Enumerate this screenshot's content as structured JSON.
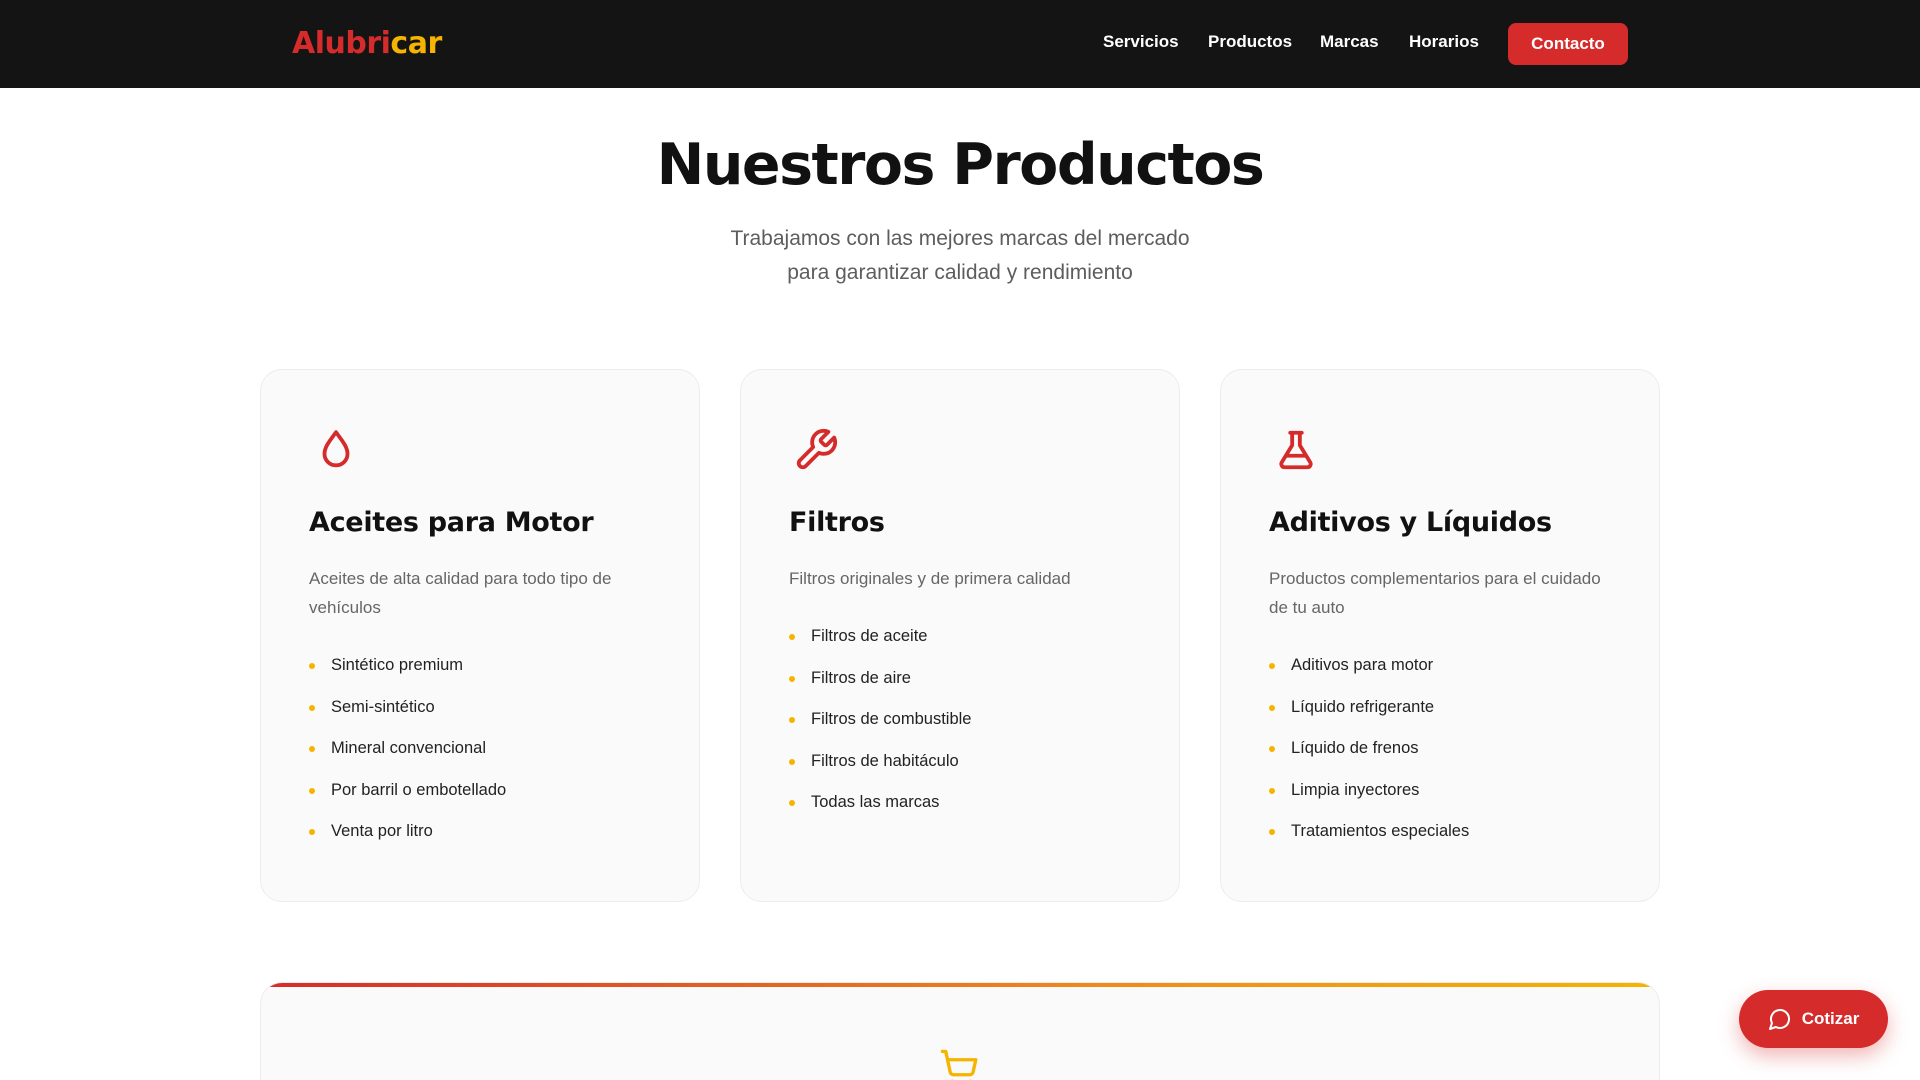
{
  "brand": {
    "part1": "Alubri",
    "part2": "car",
    "color_red": "#d62b2b",
    "color_yellow": "#f5b400"
  },
  "nav": {
    "items": [
      "Servicios",
      "Productos",
      "Marcas",
      "Horarios"
    ],
    "cta": "Contacto"
  },
  "section": {
    "title": "Nuestros Productos",
    "subtitle_line1": "Trabajamos con las mejores marcas del mercado",
    "subtitle_line2": "para garantizar calidad y rendimiento"
  },
  "cards": [
    {
      "icon": "oil-drop-icon",
      "title": "Aceites para Motor",
      "description": "Aceites de alta calidad para todo tipo de vehículos",
      "items": [
        "Sintético premium",
        "Semi-sintético",
        "Mineral convencional",
        "Por barril o embotellado",
        "Venta por litro"
      ]
    },
    {
      "icon": "wrench-icon",
      "title": "Filtros",
      "description": "Filtros originales y de primera calidad",
      "items": [
        "Filtros de aceite",
        "Filtros de aire",
        "Filtros de combustible",
        "Filtros de habitáculo",
        "Todas las marcas"
      ]
    },
    {
      "icon": "flask-icon",
      "title": "Aditivos y Líquidos",
      "description": "Productos complementarios para el cuidado de tu auto",
      "items": [
        "Aditivos para motor",
        "Líquido refrigerante",
        "Líquido de frenos",
        "Limpia inyectores",
        "Tratamientos especiales"
      ]
    }
  ],
  "banner": {
    "icon": "shopping-cart-icon"
  },
  "floating": {
    "label": "Cotizar",
    "icon": "chat-bubble-icon"
  }
}
